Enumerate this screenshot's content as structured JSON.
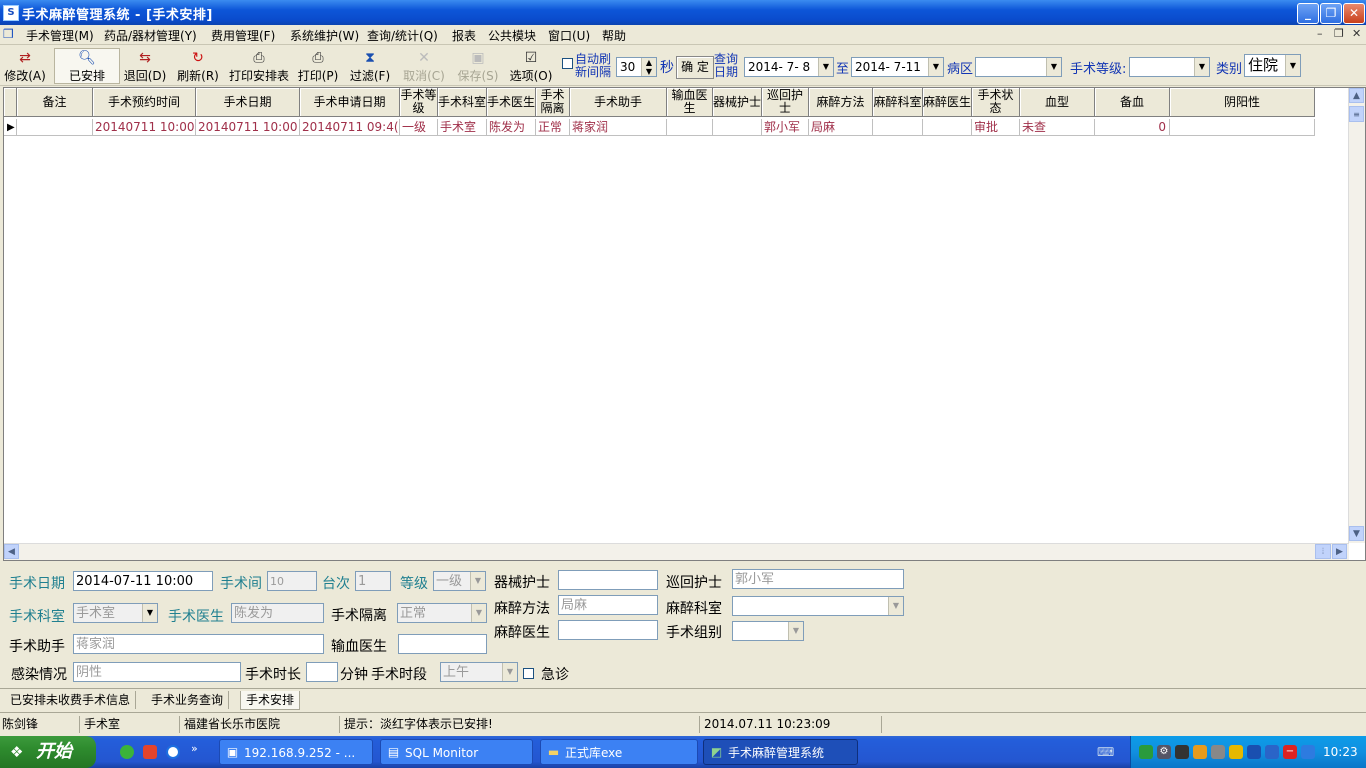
{
  "window": {
    "title": "手术麻醉管理系统 - [手术安排]"
  },
  "menu": [
    "手术管理(M)",
    "药品/器材管理(Y)",
    "费用管理(F)",
    "系统维护(W)",
    "查询/统计(Q)",
    "报表",
    "公共模块",
    "窗口(U)",
    "帮助"
  ],
  "toolbar": {
    "buttons": [
      {
        "label": "修改(A)",
        "icon": "edit-icon"
      },
      {
        "label": "已安排",
        "icon": "search-icon"
      },
      {
        "label": "退回(D)",
        "icon": "back-icon"
      },
      {
        "label": "刷新(R)",
        "icon": "refresh-icon"
      },
      {
        "label": "打印安排表",
        "icon": "printer-icon"
      },
      {
        "label": "打印(P)",
        "icon": "printer-icon"
      },
      {
        "label": "过滤(F)",
        "icon": "filter-icon"
      },
      {
        "label": "取消(C)",
        "icon": "cancel-icon"
      },
      {
        "label": "保存(S)",
        "icon": "save-icon"
      },
      {
        "label": "选项(O)",
        "icon": "options-icon"
      }
    ],
    "auto_refresh_line1": "自动刷",
    "auto_refresh_line2": "新间隔",
    "interval_value": "30",
    "seconds_label": "秒",
    "confirm_label": "确 定",
    "query_date_line1": "查询",
    "query_date_line2": "日期",
    "date_from": "2014- 7- 8",
    "to_label": "至",
    "date_to": "2014- 7-11",
    "ward_label": "病区",
    "ward_value": "",
    "level_label": "手术等级:",
    "level_value": "",
    "category_label": "类别",
    "category_value": "住院"
  },
  "grid": {
    "columns": [
      "备注",
      "手术预约时间",
      "手术日期",
      "手术申请日期",
      "手术等级",
      "手术科室",
      "手术医生",
      "手术隔离",
      "手术助手",
      "输血医生",
      "器械护士",
      "巡回护士",
      "麻醉方法",
      "麻醉科室",
      "麻醉医生",
      "手术状态",
      "血型",
      "备血",
      "阴阳性"
    ],
    "rows": [
      [
        "",
        "20140711 10:00",
        "20140711 10:00",
        "20140711 09:4(",
        "一级",
        "手术室",
        "陈发为",
        "正常",
        "蒋家润",
        "",
        "",
        "郭小军",
        "局麻",
        "",
        "",
        "审批",
        "未查",
        "0",
        ""
      ]
    ]
  },
  "form": {
    "surgery_date_label": "手术日期",
    "surgery_date": "2014-07-11 10:00",
    "room_label": "手术间",
    "room": "10",
    "seq_label": "台次",
    "seq": "1",
    "level_label": "等级",
    "level": "一级",
    "scrub_nurse_label": "器械护士",
    "scrub_nurse": "",
    "circ_nurse_label": "巡回护士",
    "circ_nurse": "郭小军",
    "dept_label": "手术科室",
    "dept": "手术室",
    "doctor_label": "手术医生",
    "doctor": "陈发为",
    "isolation_label": "手术隔离",
    "isolation": "正常",
    "anes_method_label": "麻醉方法",
    "anes_method": "局麻",
    "anes_dept_label": "麻醉科室",
    "anes_dept": "",
    "assistant_label": "手术助手",
    "assistant": "蒋家润",
    "transfusion_label": "输血医生",
    "transfusion": "",
    "anes_doctor_label": "麻醉医生",
    "anes_doctor": "",
    "group_label": "手术组别",
    "group": "",
    "infection_label": "感染情况",
    "infection": "阴性",
    "duration_label": "手术时长",
    "duration": "",
    "minutes_label": "分钟",
    "period_label": "手术时段",
    "period": "上午",
    "emergency_label": "急诊"
  },
  "tabs": [
    "已安排未收费手术信息",
    "手术业务查询",
    "手术安排"
  ],
  "status": {
    "user": "陈剑锋",
    "dept": "手术室",
    "hospital": "福建省长乐市医院",
    "hint": "提示：淡红字体表示已安排!",
    "datetime": "2014.07.11 10:23:09"
  },
  "taskbar": {
    "start": "开始",
    "items": [
      "192.168.9.252 - ...",
      "SQL Monitor",
      "正式库exe",
      "手术麻醉管理系统"
    ],
    "clock": "10:23"
  }
}
